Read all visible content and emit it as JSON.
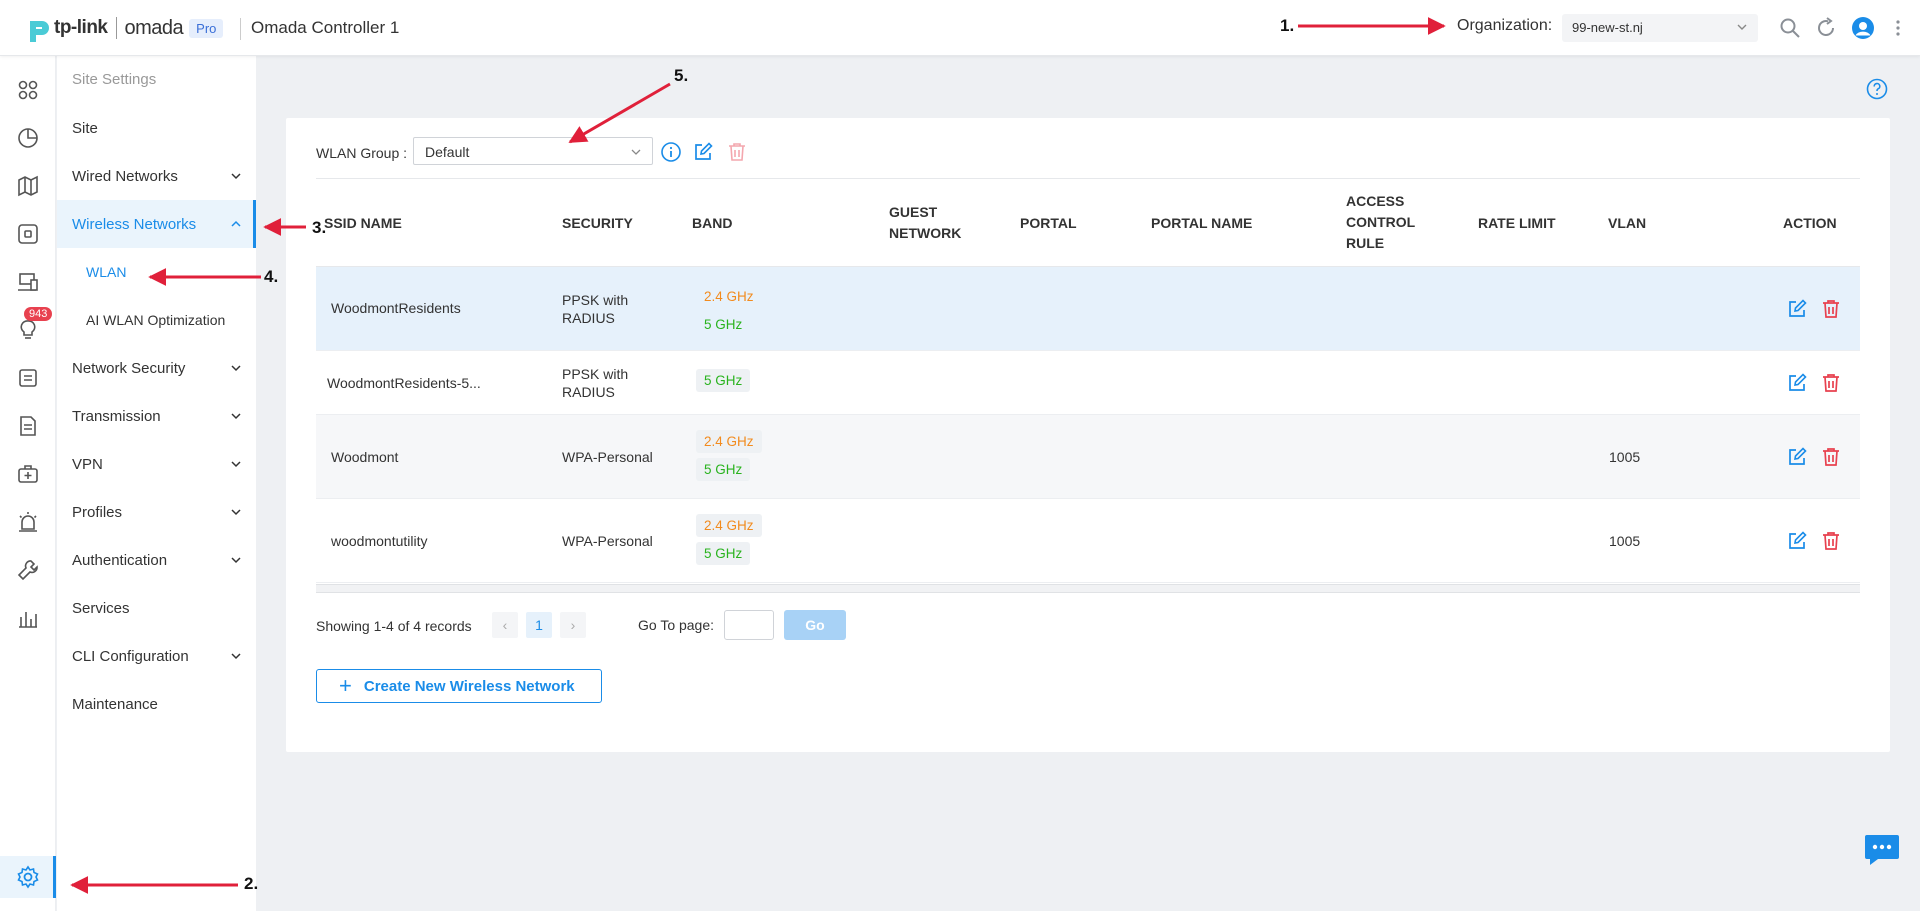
{
  "header": {
    "brand": "tp-link",
    "product": "omada",
    "edition": "Pro",
    "controller_title": "Omada Controller 1",
    "org_label": "Organization:",
    "org_value": "99-new-st.nj"
  },
  "rail": {
    "icons": [
      "dashboard-icon",
      "statistics-icon",
      "map-icon",
      "devices-icon",
      "clients-icon",
      "insights-icon",
      "logs-icon",
      "reports-icon",
      "hotspot-icon",
      "alerts-icon",
      "tools-icon",
      "analytics-icon",
      "settings-icon"
    ],
    "alert_count": "943"
  },
  "menu": {
    "heading": "Site Settings",
    "items": [
      {
        "label": "Site"
      },
      {
        "label": "Wired Networks"
      },
      {
        "label": "Wireless Networks"
      },
      {
        "label": "WLAN"
      },
      {
        "label": "AI WLAN Optimization"
      },
      {
        "label": "Network Security"
      },
      {
        "label": "Transmission"
      },
      {
        "label": "VPN"
      },
      {
        "label": "Profiles"
      },
      {
        "label": "Authentication"
      },
      {
        "label": "Services"
      },
      {
        "label": "CLI Configuration"
      },
      {
        "label": "Maintenance"
      }
    ]
  },
  "wlan_group": {
    "label": "WLAN Group :",
    "value": "Default"
  },
  "table": {
    "headers": {
      "ssid": "SSID NAME",
      "security": "SECURITY",
      "band": "BAND",
      "guest_1": "GUEST",
      "guest_2": "NETWORK",
      "portal": "PORTAL",
      "portal_name": "PORTAL NAME",
      "acl_1": "ACCESS",
      "acl_2": "CONTROL",
      "acl_3": "RULE",
      "rate_limit": "RATE LIMIT",
      "vlan": "VLAN",
      "action": "ACTION"
    },
    "rows": [
      {
        "ssid": "WoodmontResidents",
        "security_1": "PPSK with",
        "security_2": "RADIUS",
        "band_24": "2.4 GHz",
        "band_5": "5 GHz",
        "vlan": ""
      },
      {
        "ssid": "WoodmontResidents-5...",
        "security_1": "PPSK with",
        "security_2": "RADIUS",
        "band_24": "",
        "band_5": "5 GHz",
        "vlan": ""
      },
      {
        "ssid": "Woodmont",
        "security_1": "WPA-Personal",
        "security_2": "",
        "band_24": "2.4 GHz",
        "band_5": "5 GHz",
        "vlan": "1005"
      },
      {
        "ssid": "woodmontutility",
        "security_1": "WPA-Personal",
        "security_2": "",
        "band_24": "2.4 GHz",
        "band_5": "5 GHz",
        "vlan": "1005"
      }
    ]
  },
  "pagination": {
    "showing": "Showing 1-4 of 4 records",
    "current_page": "1",
    "goto_label": "Go To page:",
    "go_label": "Go"
  },
  "create_button": "Create New Wireless Network",
  "annotations": [
    "1.",
    "2.",
    "3.",
    "4.",
    "5."
  ],
  "colors": {
    "accent": "#1a8ce8",
    "band_24": "#f28b1e",
    "band_5": "#29b31e",
    "delete": "#e8414f",
    "annotation_arrow": "#e0203a"
  }
}
